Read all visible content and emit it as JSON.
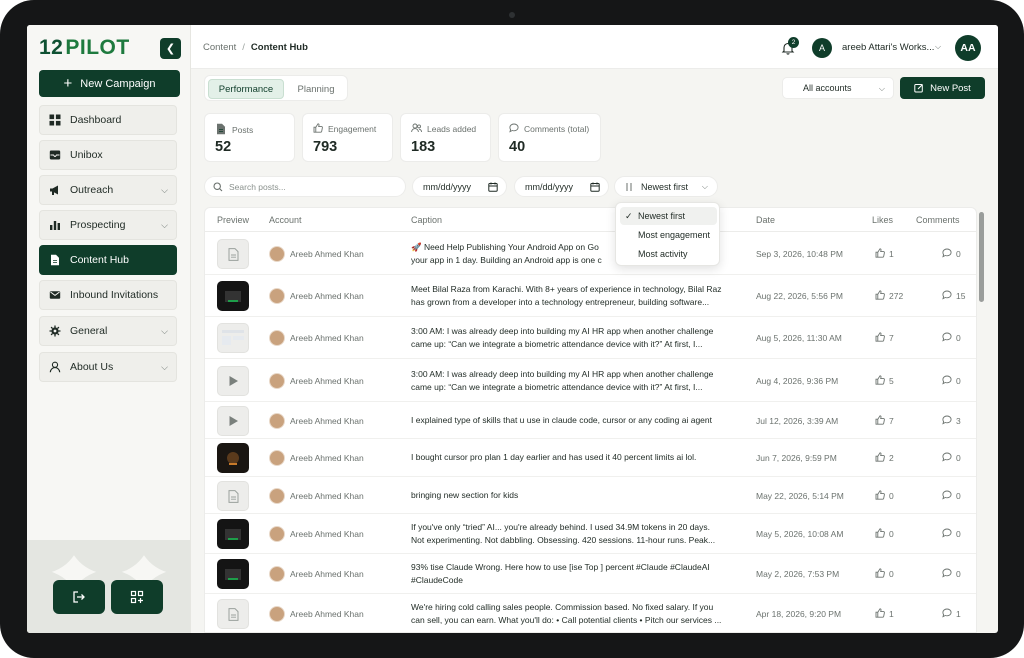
{
  "app": {
    "logo_num": "12",
    "logo_word": "PILOT"
  },
  "sidebar": {
    "new_campaign": "New Campaign",
    "items": [
      {
        "label": "Dashboard",
        "icon": "grid-icon",
        "has_chevron": false,
        "active": false
      },
      {
        "label": "Unibox",
        "icon": "inbox-icon",
        "has_chevron": false,
        "active": false
      },
      {
        "label": "Outreach",
        "icon": "megaphone-icon",
        "has_chevron": true,
        "active": false
      },
      {
        "label": "Prospecting",
        "icon": "chart-icon",
        "has_chevron": true,
        "active": false
      },
      {
        "label": "Content Hub",
        "icon": "document-icon",
        "has_chevron": false,
        "active": true
      },
      {
        "label": "Inbound Invitations",
        "icon": "mail-icon",
        "has_chevron": false,
        "active": false
      },
      {
        "label": "General",
        "icon": "gear-icon",
        "has_chevron": true,
        "active": false
      },
      {
        "label": "About Us",
        "icon": "user-icon",
        "has_chevron": true,
        "active": false
      }
    ]
  },
  "topbar": {
    "breadcrumb_parent": "Content",
    "breadcrumb_current": "Content Hub",
    "notification_count": "2",
    "workspace_initial": "A",
    "workspace_name": "areeb Attari's Works...",
    "user_initials": "AA"
  },
  "tabs": [
    {
      "label": "Performance",
      "active": true
    },
    {
      "label": "Planning",
      "active": false
    }
  ],
  "accounts_select": "All accounts",
  "new_post": "New Post",
  "stats": [
    {
      "label": "Posts",
      "value": "52",
      "icon": "document-icon"
    },
    {
      "label": "Engagement",
      "value": "793",
      "icon": "thumbs-up-icon"
    },
    {
      "label": "Leads added",
      "value": "183",
      "icon": "users-icon"
    },
    {
      "label": "Comments (total)",
      "value": "40",
      "icon": "comment-icon"
    }
  ],
  "filters": {
    "search_placeholder": "Search posts...",
    "date_from": "mm/dd/yyyy",
    "date_to": "mm/dd/yyyy",
    "sort": "Newest first"
  },
  "sort_options": [
    {
      "label": "Newest first",
      "selected": true
    },
    {
      "label": "Most engagement",
      "selected": false
    },
    {
      "label": "Most activity",
      "selected": false
    }
  ],
  "table": {
    "columns": [
      "Preview",
      "Account",
      "Caption",
      "Date",
      "Likes",
      "Comments"
    ],
    "rows": [
      {
        "thumb": "document",
        "account": "Areeb Ahmed Khan",
        "caption": [
          "🚀 Need Help Publishing Your Android App on Go",
          "your app in 1 day. Building an Android app is one c"
        ],
        "date": "Sep 3, 2026, 10:48 PM",
        "likes": "1",
        "comments": "0"
      },
      {
        "thumb": "dark",
        "account": "Areeb Ahmed Khan",
        "caption": [
          "Meet Bilal Raza from Karachi. With 8+ years of experience in technology, Bilal Raz",
          "has grown from a developer into a technology entrepreneur, building software..."
        ],
        "date": "Aug 22, 2026, 5:56 PM",
        "likes": "272",
        "comments": "15"
      },
      {
        "thumb": "light",
        "account": "Areeb Ahmed Khan",
        "caption": [
          "3:00 AM: I was already deep into building my AI HR app when another challenge",
          "came up: “Can we integrate a biometric attendance device with it?” At first, I..."
        ],
        "date": "Aug 5, 2026, 11:30 AM",
        "likes": "7",
        "comments": "0"
      },
      {
        "thumb": "play",
        "account": "Areeb Ahmed Khan",
        "caption": [
          "3:00 AM: I was already deep into building my AI HR app when another challenge",
          "came up: “Can we integrate a biometric attendance device with it?” At first, I..."
        ],
        "date": "Aug 4, 2026, 9:36 PM",
        "likes": "5",
        "comments": "0"
      },
      {
        "thumb": "play",
        "account": "Areeb Ahmed Khan",
        "caption": [
          "I explained type of skills that u use in claude code, cursor or any coding ai agent"
        ],
        "date": "Jul 12, 2026, 3:39 AM",
        "likes": "7",
        "comments": "3"
      },
      {
        "thumb": "dark2",
        "account": "Areeb Ahmed Khan",
        "caption": [
          "I bought cursor pro plan 1 day earlier and has used it 40 percent limits ai lol."
        ],
        "date": "Jun 7, 2026, 9:59 PM",
        "likes": "2",
        "comments": "0"
      },
      {
        "thumb": "document",
        "account": "Areeb Ahmed Khan",
        "caption": [
          "bringing new section for kids"
        ],
        "date": "May 22, 2026, 5:14 PM",
        "likes": "0",
        "comments": "0"
      },
      {
        "thumb": "dark",
        "account": "Areeb Ahmed Khan",
        "caption": [
          "If you've only “tried” AI... you're already behind. I used 34.9M tokens in 20 days.",
          "Not experimenting. Not dabbling. Obsessing. 420 sessions. 11-hour runs. Peak..."
        ],
        "date": "May 5, 2026, 10:08 AM",
        "likes": "0",
        "comments": "0"
      },
      {
        "thumb": "dark",
        "account": "Areeb Ahmed Khan",
        "caption": [
          "93% tise Claude Wrong. Here how to use [ise Top ] percent #Claude #ClaudeAI",
          "#ClaudeCode"
        ],
        "date": "May 2, 2026, 7:53 PM",
        "likes": "0",
        "comments": "0"
      },
      {
        "thumb": "document",
        "account": "Areeb Ahmed Khan",
        "caption": [
          "We're hiring cold calling sales people. Commission based. No fixed salary. If you",
          "can sell, you can earn. What you'll do: • Call potential clients • Pitch our services ..."
        ],
        "date": "Apr 18, 2026, 9:20 PM",
        "likes": "1",
        "comments": "1"
      }
    ]
  },
  "colors": {
    "brand_dark_green": "#0f3d2a",
    "active_tab_bg": "#e3f0e8"
  }
}
